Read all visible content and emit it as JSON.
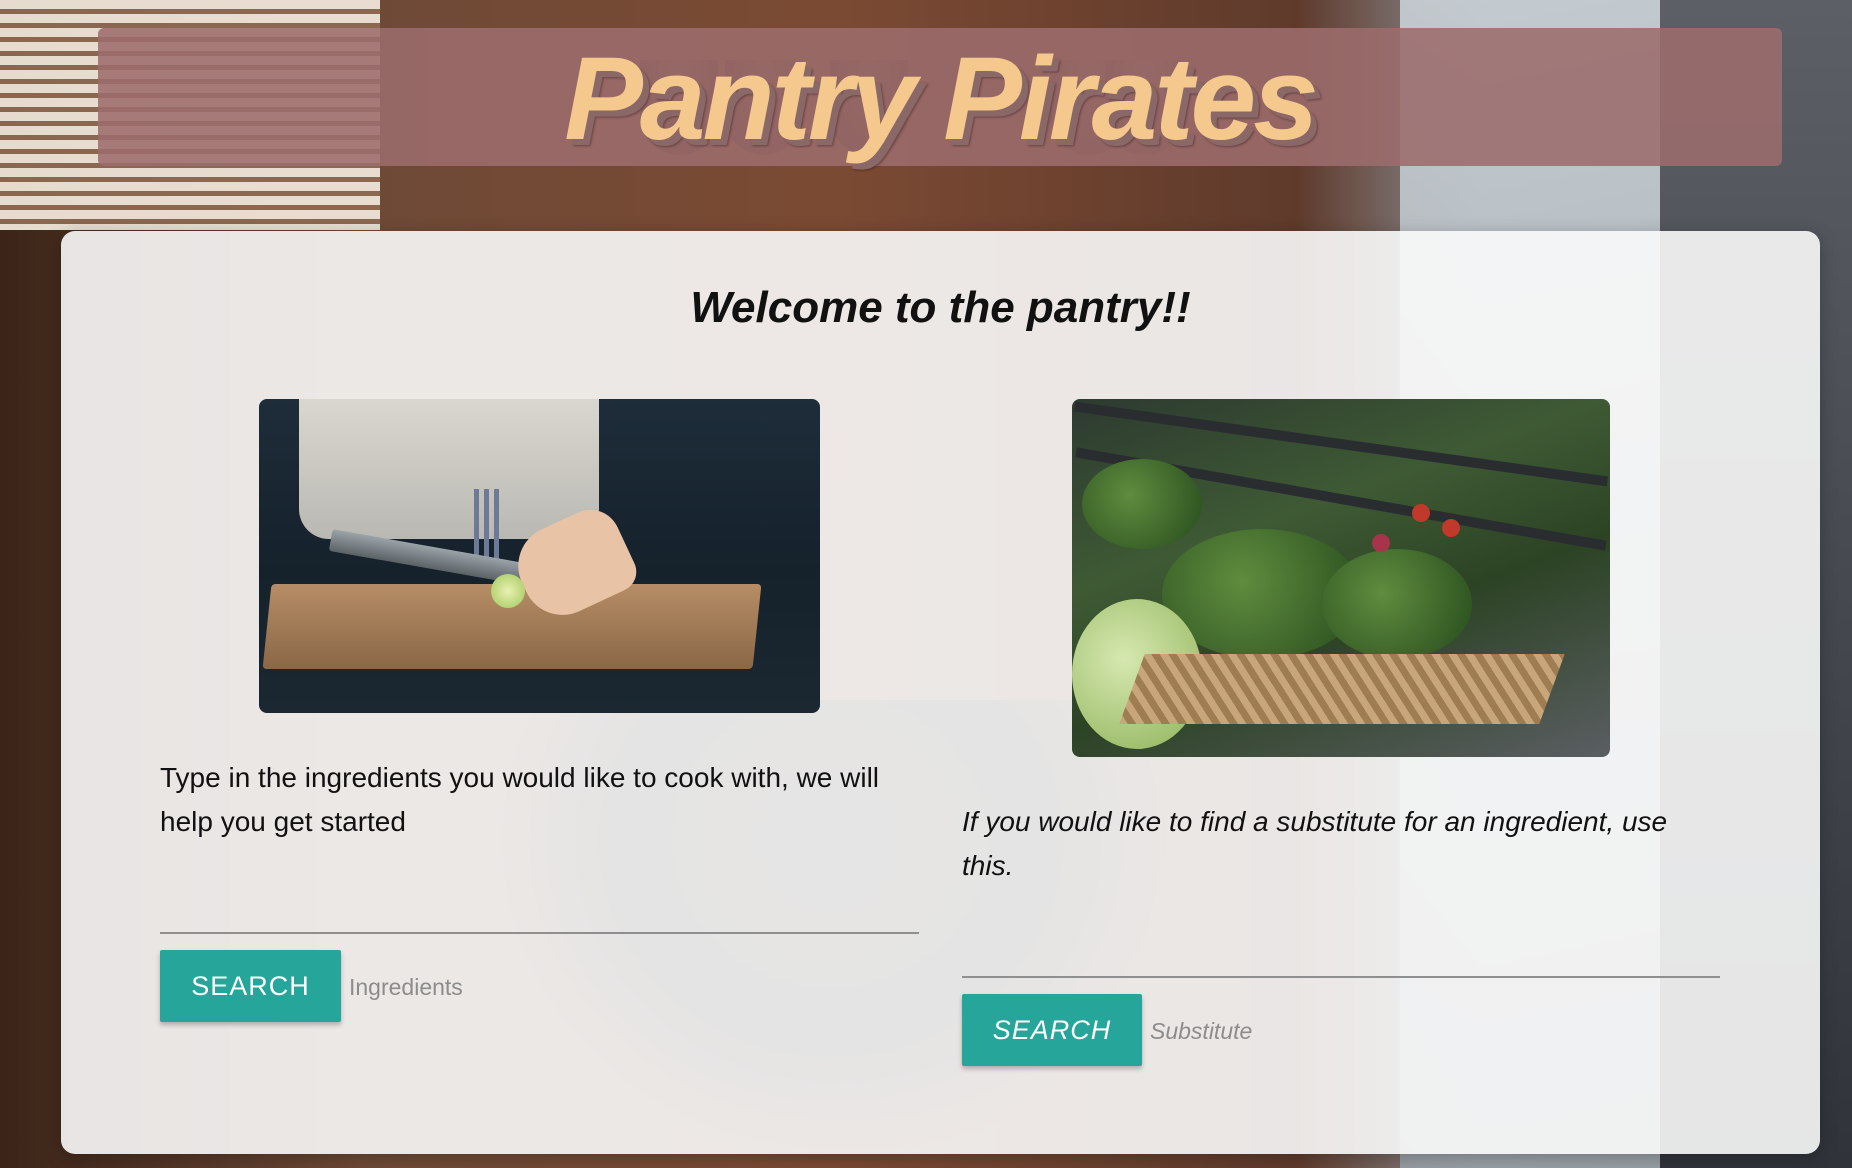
{
  "header": {
    "title": "Pantry Pirates"
  },
  "main": {
    "welcome": "Welcome to the pantry!!",
    "ingredients": {
      "description": "Type in the ingredients you would like to cook with, we will help you get started",
      "button_label": "SEARCH",
      "placeholder": "Ingredients"
    },
    "substitute": {
      "description": "If you would like to find a substitute for an ingredient, use this.",
      "button_label": "SEARCH",
      "placeholder": "Substitute"
    }
  },
  "colors": {
    "accent": "#26a69a",
    "header_bg": "#9c6c6c",
    "brand_text": "#f5c98d"
  }
}
